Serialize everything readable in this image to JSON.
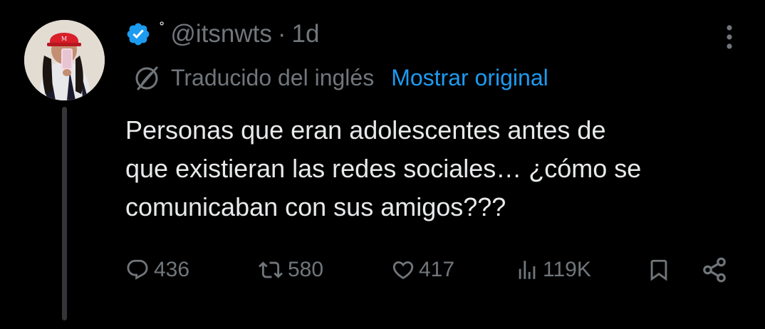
{
  "tweet": {
    "name_glyph": "˚",
    "handle": "@itsnwts",
    "separator": "·",
    "time": "1d",
    "translated_label": "Traducido del inglés",
    "show_original_label": "Mostrar original",
    "text_lines": [
      "Personas que eran adolescentes antes de",
      "que existieran las redes sociales… ¿cómo se",
      "comunicaban con sus amigos???"
    ],
    "stats": {
      "replies": "436",
      "retweets": "580",
      "likes": "417",
      "views": "119K"
    }
  },
  "icons": {
    "verified": "verified-badge-icon",
    "more": "more-options-icon",
    "translate": "translate-globe-icon",
    "reply": "reply-bubble-icon",
    "retweet": "retweet-icon",
    "like": "heart-icon",
    "views": "views-bar-icon",
    "bookmark": "bookmark-icon",
    "share": "share-icon"
  },
  "colors": {
    "background": "#000000",
    "text": "#e7e9ea",
    "muted": "#71767b",
    "accent": "#1d9bf0"
  }
}
